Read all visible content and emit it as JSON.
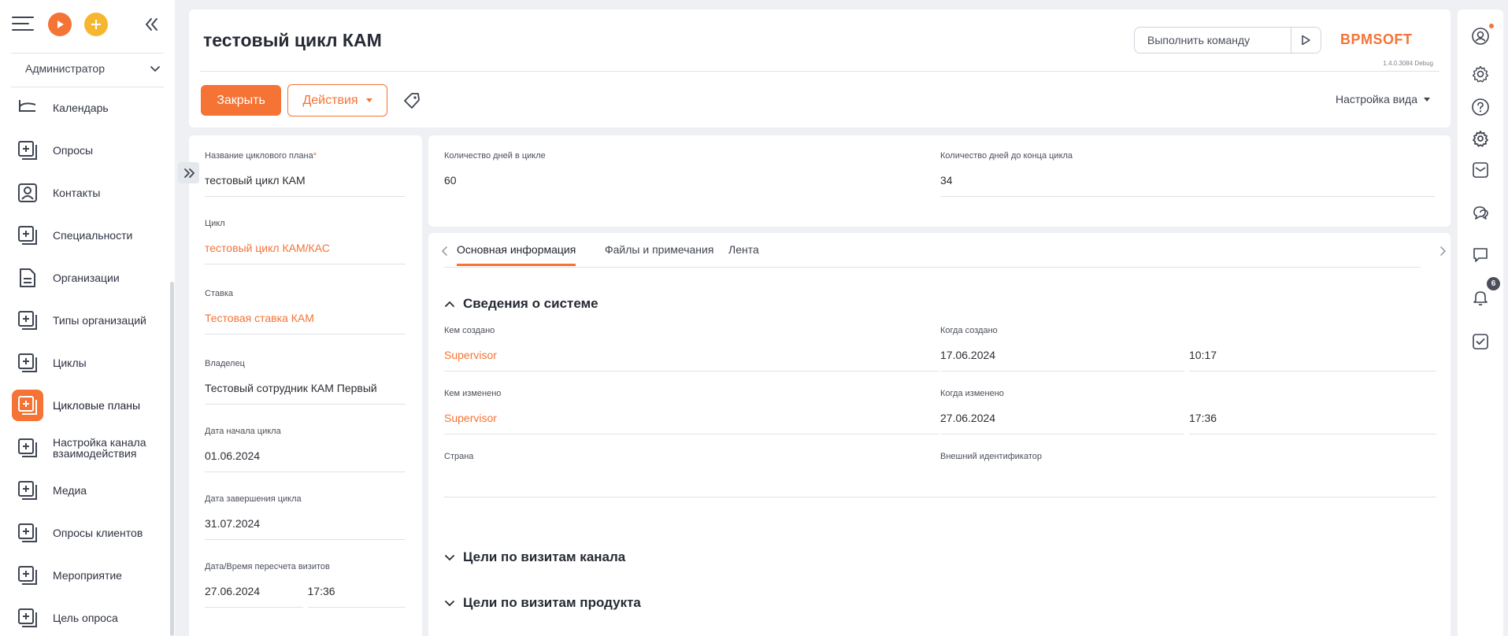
{
  "sidebar": {
    "role": "Администратор",
    "items": [
      {
        "label": "Календарь",
        "icon": "calendar-icon"
      },
      {
        "label": "Опросы",
        "icon": "section-icon"
      },
      {
        "label": "Контакты",
        "icon": "contact-icon"
      },
      {
        "label": "Специальности",
        "icon": "section-icon"
      },
      {
        "label": "Организации",
        "icon": "document-icon"
      },
      {
        "label": "Типы организаций",
        "icon": "section-icon"
      },
      {
        "label": "Циклы",
        "icon": "section-icon"
      },
      {
        "label": "Цикловые планы",
        "icon": "section-icon",
        "active": true
      },
      {
        "label": "Настройка канала взаимодействия",
        "icon": "section-icon"
      },
      {
        "label": "Медиа",
        "icon": "section-icon"
      },
      {
        "label": "Опросы клиентов",
        "icon": "section-icon"
      },
      {
        "label": "Мероприятие",
        "icon": "section-icon"
      },
      {
        "label": "Цель опроса",
        "icon": "section-icon"
      }
    ]
  },
  "header": {
    "title": "тестовый цикл КАМ",
    "command_placeholder": "Выполнить команду",
    "logo_text": "BPMSOFT",
    "version": "1.4.0.3084 Debug",
    "close_label": "Закрыть",
    "actions_label": "Действия",
    "view_setup_label": "Настройка вида"
  },
  "profile": {
    "plan_name_caption": "Название циклового плана",
    "plan_name_value": "тестовый цикл КАМ",
    "cycle_caption": "Цикл",
    "cycle_value": "тестовый цикл КАМ/КАС",
    "rate_caption": "Ставка",
    "rate_value": "Тестовая ставка КАМ",
    "owner_caption": "Владелец",
    "owner_value": "Тестовый сотрудник КАМ Первый",
    "start_caption": "Дата начала цикла",
    "start_value": "01.06.2024",
    "end_caption": "Дата завершения цикла",
    "end_value": "31.07.2024",
    "recalc_caption": "Дата/Время пересчета визитов",
    "recalc_date": "27.06.2024",
    "recalc_time": "17:36"
  },
  "days": {
    "days_in_cycle_caption": "Количество дней в цикле",
    "days_in_cycle_value": "60",
    "days_left_caption": "Количество дней до конца цикла",
    "days_left_value": "34"
  },
  "tabs": [
    {
      "label": "Основная информация",
      "active": true
    },
    {
      "label": "Файлы и примечания"
    },
    {
      "label": "Лента"
    }
  ],
  "system_info": {
    "title": "Сведения о системе",
    "created_by_caption": "Кем создано",
    "created_by_value": "Supervisor",
    "created_on_caption": "Когда создано",
    "created_on_date": "17.06.2024",
    "created_on_time": "10:17",
    "modified_by_caption": "Кем изменено",
    "modified_by_value": "Supervisor",
    "modified_on_caption": "Когда изменено",
    "modified_on_date": "27.06.2024",
    "modified_on_time": "17:36",
    "country_caption": "Страна",
    "country_value": "",
    "external_id_caption": "Внешний идентификатор",
    "external_id_value": ""
  },
  "sections": {
    "channel_goals": "Цели по визитам канала",
    "product_goals": "Цели по визитам продукта"
  },
  "rail": {
    "notifications_count": "6"
  },
  "colors": {
    "accent": "#f47335",
    "accent_yellow": "#f7b62f",
    "background": "#eef0f3",
    "text": "#2b2d33"
  }
}
